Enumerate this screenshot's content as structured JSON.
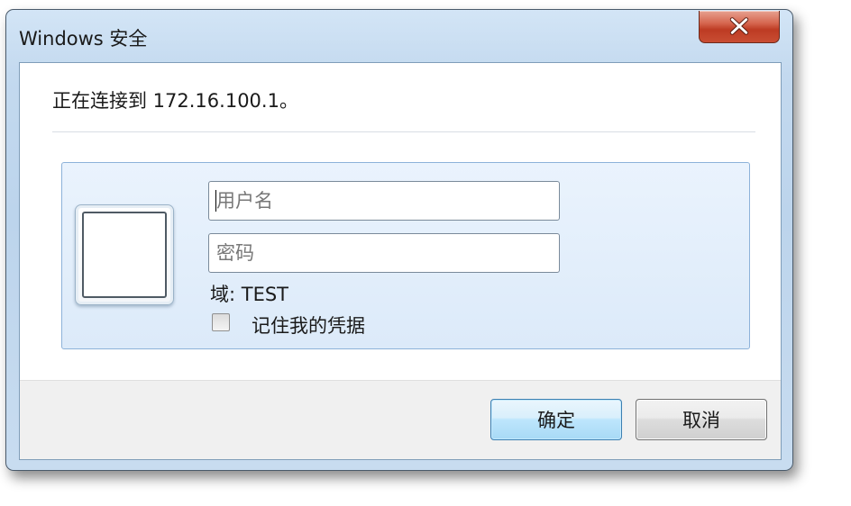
{
  "window": {
    "title": "Windows 安全",
    "close_icon": "close-icon"
  },
  "message": "正在连接到 172.16.100.1。",
  "credentials": {
    "user_tile_icon": "user-tile-icon",
    "username": {
      "placeholder": "用户名",
      "value": ""
    },
    "password": {
      "placeholder": "密码",
      "value": ""
    },
    "domain_label": "域: TEST",
    "remember": {
      "label": "记住我的凭据",
      "checked": false
    }
  },
  "buttons": {
    "ok": "确定",
    "cancel": "取消"
  },
  "colors": {
    "close_button": "#c94d33",
    "panel_background": "#dceaf9",
    "ok_button_border": "#3c7fb1"
  }
}
